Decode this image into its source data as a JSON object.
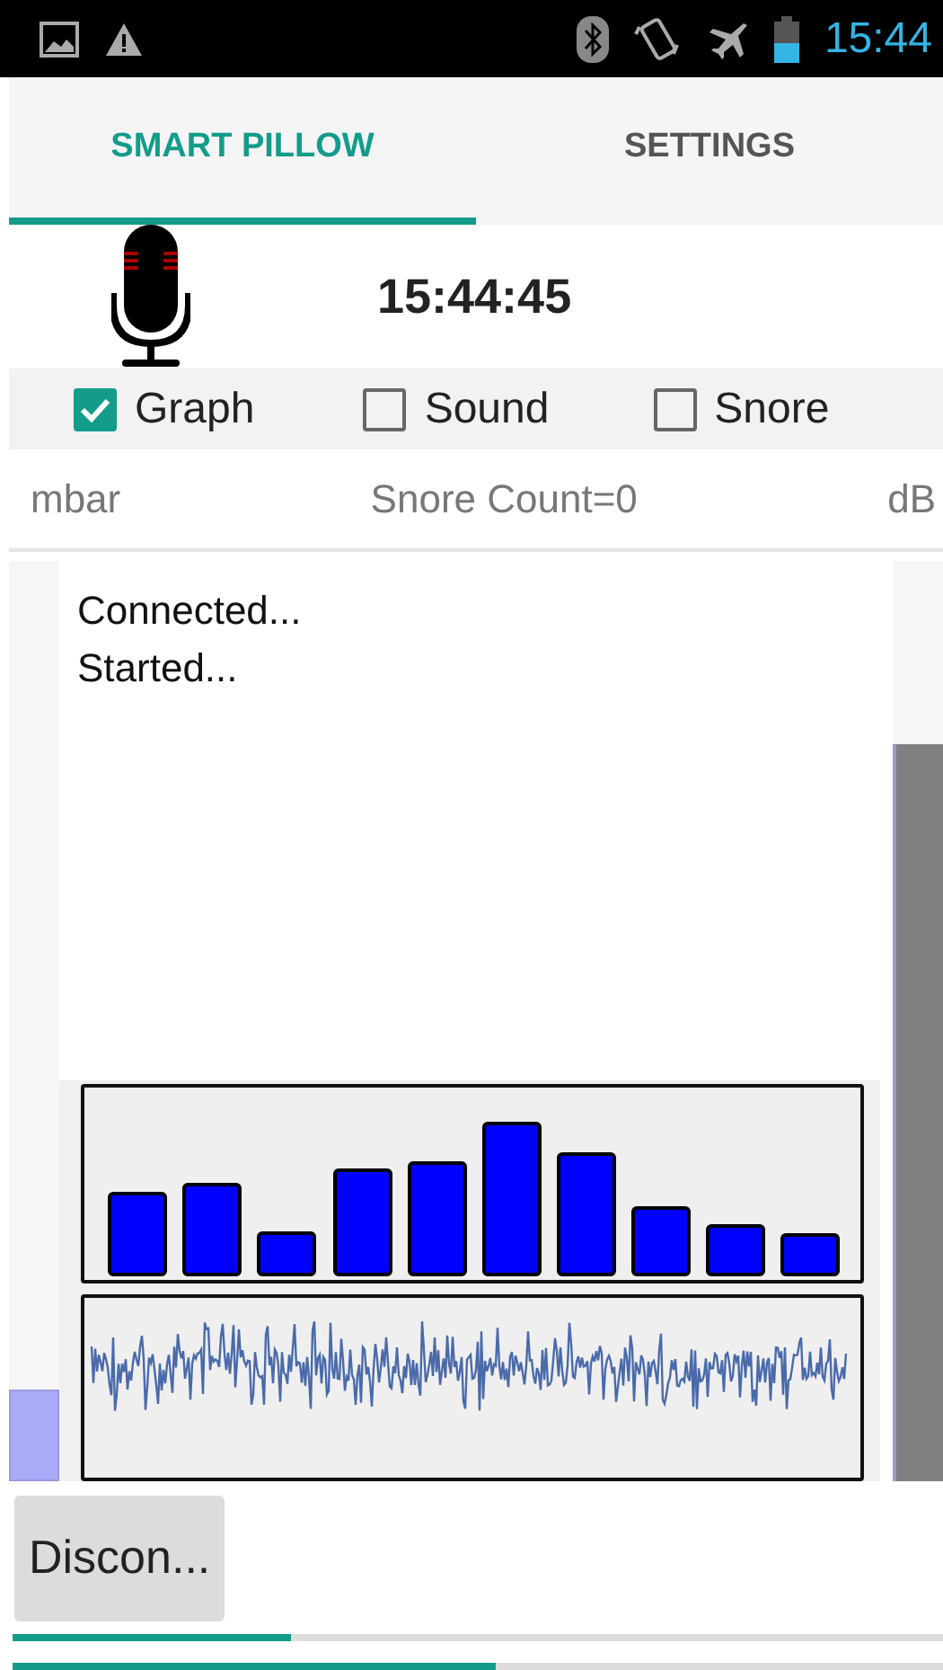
{
  "status_bar": {
    "time": "15:44"
  },
  "tabs": [
    {
      "label": "SMART PILLOW",
      "selected": true
    },
    {
      "label": "SETTINGS",
      "selected": false
    }
  ],
  "clock": "15:44:45",
  "options": [
    {
      "label": "Graph",
      "checked": true
    },
    {
      "label": "Sound",
      "checked": false
    },
    {
      "label": "Snore",
      "checked": false
    }
  ],
  "readings": {
    "left": "mbar",
    "center": "Snore Count=0",
    "right": "dB"
  },
  "log": [
    "Connected...",
    "Started..."
  ],
  "pressure_meter": {
    "level": 0.1
  },
  "sound_meter": {
    "level": 0.8
  },
  "button": "Discon...",
  "progress": [
    {
      "level": 0.3
    },
    {
      "level": 0.52
    }
  ]
}
